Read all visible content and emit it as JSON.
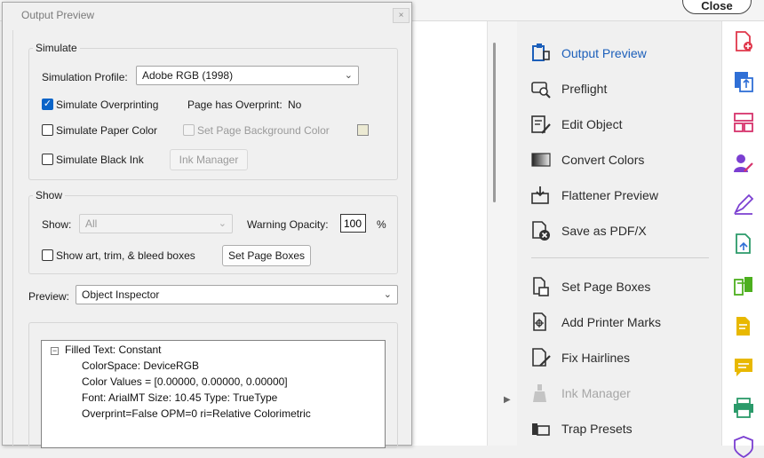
{
  "app": {
    "close_label": "Close"
  },
  "dialog": {
    "title": "Output Preview",
    "close_glyph": "×",
    "simulate": {
      "legend": "Simulate",
      "profile_label": "Simulation Profile:",
      "profile_value": "Adobe RGB (1998)",
      "simulate_overprinting": {
        "label": "Simulate Overprinting",
        "checked": true
      },
      "page_has_overprint_label": "Page has Overprint:",
      "page_has_overprint_value": "No",
      "simulate_paper_color": {
        "label": "Simulate Paper Color",
        "checked": false
      },
      "set_page_background": {
        "label": "Set Page Background Color",
        "checked": false,
        "disabled": true
      },
      "background_swatch_color": "#ecead3",
      "simulate_black_ink": {
        "label": "Simulate Black Ink",
        "checked": false
      },
      "ink_manager_label": "Ink Manager"
    },
    "show": {
      "legend": "Show",
      "show_label": "Show:",
      "show_value": "All",
      "warning_opacity_label": "Warning Opacity:",
      "warning_opacity_value": "100",
      "percent": "%",
      "show_boxes": {
        "label": "Show art, trim, & bleed boxes",
        "checked": false
      },
      "set_page_boxes_label": "Set Page Boxes"
    },
    "preview": {
      "label": "Preview:",
      "value": "Object Inspector"
    },
    "inspector": {
      "toggle": "−",
      "root": "Filled Text: Constant",
      "lines": [
        "ColorSpace: DeviceRGB",
        "Color Values = [0.00000, 0.00000, 0.00000]",
        "Font: ArialMT Size: 10.45 Type: TrueType",
        "Overprint=False OPM=0 ri=Relative Colorimetric"
      ]
    }
  },
  "tools": [
    {
      "label": "Output Preview",
      "icon": "output-preview-icon",
      "active": true
    },
    {
      "label": "Preflight",
      "icon": "preflight-icon"
    },
    {
      "label": "Edit Object",
      "icon": "edit-object-icon"
    },
    {
      "label": "Convert Colors",
      "icon": "convert-colors-icon"
    },
    {
      "label": "Flattener Preview",
      "icon": "flattener-preview-icon"
    },
    {
      "label": "Save as PDF/X",
      "icon": "save-pdfx-icon"
    },
    {
      "label": "Set Page Boxes",
      "icon": "set-page-boxes-icon"
    },
    {
      "label": "Add Printer Marks",
      "icon": "printer-marks-icon"
    },
    {
      "label": "Fix Hairlines",
      "icon": "fix-hairlines-icon"
    },
    {
      "label": "Ink Manager",
      "icon": "ink-manager-icon",
      "disabled": true
    },
    {
      "label": "Trap Presets",
      "icon": "trap-presets-icon"
    }
  ],
  "right_toolbar": {
    "colors": {
      "red": "#e0374b",
      "blue": "#2f6fd6",
      "pink": "#d6336c",
      "purple": "#7b3fd1",
      "green": "#2b9a6a",
      "lime": "#4caf1e",
      "yellow": "#e8b800"
    },
    "icons": [
      "create-pdf-icon",
      "export-pdf-icon",
      "organize-pages-icon",
      "request-signatures-icon",
      "fill-sign-icon",
      "share-icon",
      "compare-icon",
      "comment-icon",
      "sticky-note-icon",
      "print-production-icon",
      "protect-icon"
    ]
  }
}
